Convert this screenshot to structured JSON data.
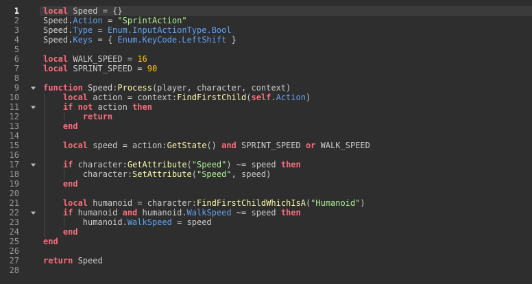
{
  "editor": {
    "active_line": 1,
    "lines": [
      {
        "n": "1",
        "indent": 0,
        "fold": false,
        "tokens": [
          [
            "keyword",
            "local"
          ],
          [
            "plain",
            " Speed = {}"
          ]
        ]
      },
      {
        "n": "2",
        "indent": 0,
        "fold": false,
        "tokens": [
          [
            "plain",
            "Speed."
          ],
          [
            "prop",
            "Action"
          ],
          [
            "plain",
            " = "
          ],
          [
            "string",
            "\"SprintAction\""
          ]
        ]
      },
      {
        "n": "3",
        "indent": 0,
        "fold": false,
        "tokens": [
          [
            "plain",
            "Speed."
          ],
          [
            "prop",
            "Type"
          ],
          [
            "plain",
            " = "
          ],
          [
            "prop",
            "Enum.InputActionType.Bool"
          ]
        ]
      },
      {
        "n": "4",
        "indent": 0,
        "fold": false,
        "tokens": [
          [
            "plain",
            "Speed."
          ],
          [
            "prop",
            "Keys"
          ],
          [
            "plain",
            " = { "
          ],
          [
            "prop",
            "Enum.KeyCode.LeftShift"
          ],
          [
            "plain",
            " }"
          ]
        ]
      },
      {
        "n": "5",
        "indent": 0,
        "fold": false,
        "tokens": []
      },
      {
        "n": "6",
        "indent": 0,
        "fold": false,
        "tokens": [
          [
            "keyword",
            "local"
          ],
          [
            "plain",
            " WALK_SPEED = "
          ],
          [
            "number",
            "16"
          ]
        ]
      },
      {
        "n": "7",
        "indent": 0,
        "fold": false,
        "tokens": [
          [
            "keyword",
            "local"
          ],
          [
            "plain",
            " SPRINT_SPEED = "
          ],
          [
            "number",
            "90"
          ]
        ]
      },
      {
        "n": "8",
        "indent": 0,
        "fold": false,
        "tokens": []
      },
      {
        "n": "9",
        "indent": 0,
        "fold": true,
        "tokens": [
          [
            "keyword",
            "function"
          ],
          [
            "plain",
            " Speed:"
          ],
          [
            "func",
            "Process"
          ],
          [
            "plain",
            "(player, character, context)"
          ]
        ]
      },
      {
        "n": "10",
        "indent": 1,
        "fold": false,
        "tokens": [
          [
            "keyword",
            "local"
          ],
          [
            "plain",
            " action = context:"
          ],
          [
            "func",
            "FindFirstChild"
          ],
          [
            "plain",
            "("
          ],
          [
            "keyword",
            "self"
          ],
          [
            "plain",
            "."
          ],
          [
            "prop",
            "Action"
          ],
          [
            "plain",
            ")"
          ]
        ]
      },
      {
        "n": "11",
        "indent": 1,
        "fold": true,
        "tokens": [
          [
            "keyword",
            "if"
          ],
          [
            "plain",
            " "
          ],
          [
            "keyword",
            "not"
          ],
          [
            "plain",
            " action "
          ],
          [
            "keyword",
            "then"
          ]
        ]
      },
      {
        "n": "12",
        "indent": 2,
        "fold": false,
        "tokens": [
          [
            "keyword",
            "return"
          ]
        ]
      },
      {
        "n": "13",
        "indent": 1,
        "fold": false,
        "tokens": [
          [
            "keyword",
            "end"
          ]
        ]
      },
      {
        "n": "14",
        "indent": 0,
        "fold": false,
        "tokens": []
      },
      {
        "n": "15",
        "indent": 1,
        "fold": false,
        "tokens": [
          [
            "keyword",
            "local"
          ],
          [
            "plain",
            " speed = action:"
          ],
          [
            "func",
            "GetState"
          ],
          [
            "plain",
            "() "
          ],
          [
            "keyword",
            "and"
          ],
          [
            "plain",
            " SPRINT_SPEED "
          ],
          [
            "keyword",
            "or"
          ],
          [
            "plain",
            " WALK_SPEED"
          ]
        ]
      },
      {
        "n": "16",
        "indent": 0,
        "fold": false,
        "tokens": []
      },
      {
        "n": "17",
        "indent": 1,
        "fold": true,
        "tokens": [
          [
            "keyword",
            "if"
          ],
          [
            "plain",
            " character:"
          ],
          [
            "func",
            "GetAttribute"
          ],
          [
            "plain",
            "("
          ],
          [
            "string",
            "\"Speed\""
          ],
          [
            "plain",
            ") ~= speed "
          ],
          [
            "keyword",
            "then"
          ]
        ]
      },
      {
        "n": "18",
        "indent": 2,
        "fold": false,
        "tokens": [
          [
            "plain",
            "character:"
          ],
          [
            "func",
            "SetAttribute"
          ],
          [
            "plain",
            "("
          ],
          [
            "string",
            "\"Speed\""
          ],
          [
            "plain",
            ", speed)"
          ]
        ]
      },
      {
        "n": "19",
        "indent": 1,
        "fold": false,
        "tokens": [
          [
            "keyword",
            "end"
          ]
        ]
      },
      {
        "n": "20",
        "indent": 0,
        "fold": false,
        "tokens": []
      },
      {
        "n": "21",
        "indent": 1,
        "fold": false,
        "tokens": [
          [
            "keyword",
            "local"
          ],
          [
            "plain",
            " humanoid = character:"
          ],
          [
            "func",
            "FindFirstChildWhichIsA"
          ],
          [
            "plain",
            "("
          ],
          [
            "string",
            "\"Humanoid\""
          ],
          [
            "plain",
            ")"
          ]
        ]
      },
      {
        "n": "22",
        "indent": 1,
        "fold": true,
        "tokens": [
          [
            "keyword",
            "if"
          ],
          [
            "plain",
            " humanoid "
          ],
          [
            "keyword",
            "and"
          ],
          [
            "plain",
            " humanoid."
          ],
          [
            "prop",
            "WalkSpeed"
          ],
          [
            "plain",
            " ~= speed "
          ],
          [
            "keyword",
            "then"
          ]
        ]
      },
      {
        "n": "23",
        "indent": 2,
        "fold": false,
        "tokens": [
          [
            "plain",
            "humanoid."
          ],
          [
            "prop",
            "WalkSpeed"
          ],
          [
            "plain",
            " = speed"
          ]
        ]
      },
      {
        "n": "24",
        "indent": 1,
        "fold": false,
        "tokens": [
          [
            "keyword",
            "end"
          ]
        ]
      },
      {
        "n": "25",
        "indent": 0,
        "fold": false,
        "tokens": [
          [
            "keyword",
            "end"
          ]
        ]
      },
      {
        "n": "26",
        "indent": 0,
        "fold": false,
        "tokens": []
      },
      {
        "n": "27",
        "indent": 0,
        "fold": false,
        "tokens": [
          [
            "keyword",
            "return"
          ],
          [
            "plain",
            " Speed"
          ]
        ]
      },
      {
        "n": "28",
        "indent": 0,
        "fold": false,
        "tokens": []
      }
    ],
    "colors": {
      "background": "#2e2e2e",
      "active_line": "#3b3b3b",
      "keyword": "#f86d7c",
      "string": "#adf195",
      "number": "#ffc600",
      "function": "#fdfbac",
      "property": "#61a1f1",
      "text": "#cccccc",
      "line_number": "#9a9a9a"
    },
    "fold_icon": "chevron-down-icon"
  }
}
